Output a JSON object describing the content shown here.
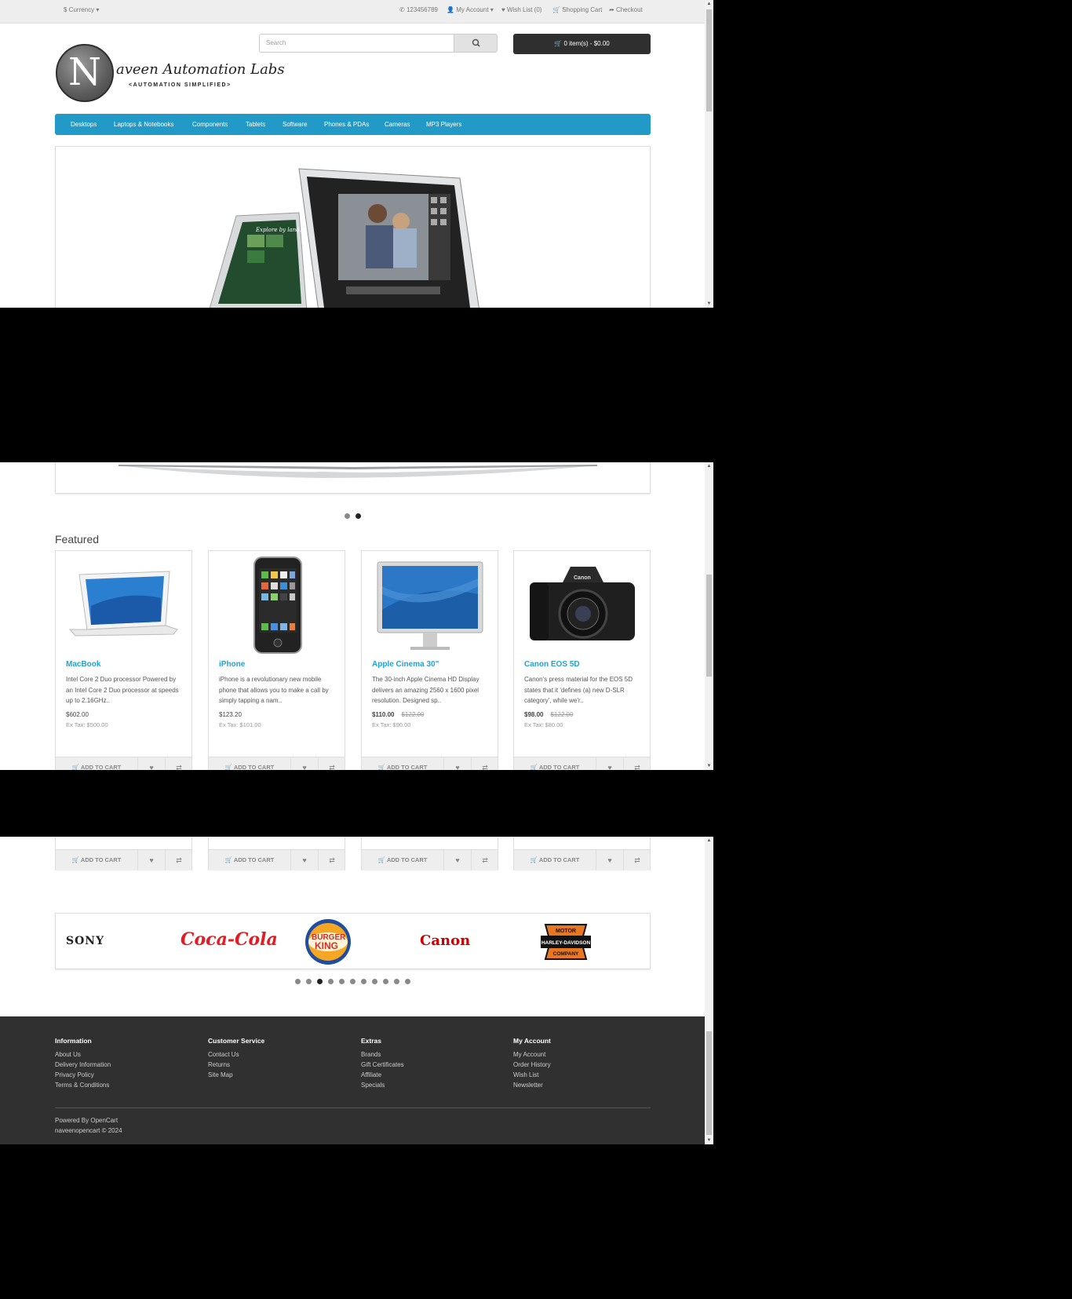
{
  "topbar": {
    "currency": "$ Currency",
    "phone": "123456789",
    "my_account": "My Account",
    "wish_list": "Wish List (0)",
    "shopping_cart": "Shopping Cart",
    "checkout": "Checkout"
  },
  "logo": {
    "letter": "N",
    "script": "aveen Automation Labs",
    "tagline": "<AUTOMATION SIMPLIFIED>"
  },
  "search": {
    "placeholder": "Search"
  },
  "cart": {
    "label": "0 item(s) - $0.00"
  },
  "menu": [
    "Desktops",
    "Laptops & Notebooks",
    "Components",
    "Tablets",
    "Software",
    "Phones & PDAs",
    "Cameras",
    "MP3 Players"
  ],
  "slideshow": {
    "slides": 2,
    "active_slide": 2,
    "screen_caption": "Explore by land."
  },
  "featured": {
    "heading": "Featured",
    "add_to_cart": "ADD TO CART",
    "products": [
      {
        "name": "MacBook",
        "desc": "Intel Core 2 Duo processor Powered by an Intel Core 2 Duo processor at speeds up to 2.16GHz..",
        "price": "$602.00",
        "old_price": "",
        "ex_tax": "Ex Tax: $500.00"
      },
      {
        "name": "iPhone",
        "desc": "iPhone is a revolutionary new mobile phone that allows you to make a call by simply tapping a nam..",
        "price": "$123.20",
        "old_price": "",
        "ex_tax": "Ex Tax: $101.00"
      },
      {
        "name": "Apple Cinema 30\"",
        "desc": "The 30-inch Apple Cinema HD Display delivers an amazing 2560 x 1600 pixel resolution. Designed sp..",
        "price": "$110.00",
        "old_price": "$122.00",
        "ex_tax": "Ex Tax: $90.00"
      },
      {
        "name": "Canon EOS 5D",
        "desc": "Canon's press material for the EOS 5D states that it 'defines (a) new D-SLR category', while we'r..",
        "price": "$98.00",
        "old_price": "$122.00",
        "ex_tax": "Ex Tax: $80.00"
      }
    ]
  },
  "brands": {
    "items": [
      "SONY",
      "Coca-Cola",
      "BURGER KING",
      "Canon",
      "HARLEY-DAVIDSON"
    ],
    "harley_top": "MOTOR",
    "harley_mid": "HARLEY-DAVIDSON",
    "harley_bottom": "COMPANY",
    "pages": 11,
    "active_page": 3
  },
  "footer": {
    "columns": [
      {
        "title": "Information",
        "links": [
          "About Us",
          "Delivery Information",
          "Privacy Policy",
          "Terms & Conditions"
        ]
      },
      {
        "title": "Customer Service",
        "links": [
          "Contact Us",
          "Returns",
          "Site Map"
        ]
      },
      {
        "title": "Extras",
        "links": [
          "Brands",
          "Gift Certificates",
          "Affiliate",
          "Specials"
        ]
      },
      {
        "title": "My Account",
        "links": [
          "My Account",
          "Order History",
          "Wish List",
          "Newsletter"
        ]
      }
    ],
    "powered_prefix": "Powered By ",
    "powered_link": "OpenCart",
    "copyright": "naveenopencart © 2024"
  },
  "colors": {
    "menu_blue": "#229ac8",
    "link_blue": "#23a1d1",
    "footer_bg": "#303030",
    "cart_bg": "#2f2f2f"
  }
}
